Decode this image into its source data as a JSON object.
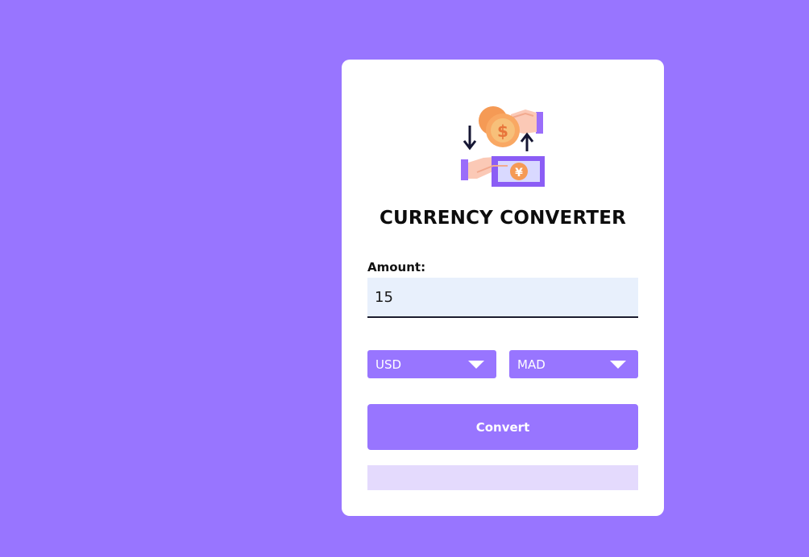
{
  "app": {
    "title": "CURRENCY CONVERTER",
    "logo_icon": "currency-exchange-icon"
  },
  "form": {
    "amount_label": "Amount:",
    "amount_value": "15",
    "from_currency": "USD",
    "to_currency": "MAD",
    "convert_label": "Convert",
    "result_text": ""
  },
  "colors": {
    "background": "#9875ff",
    "card": "#ffffff",
    "accent": "#9875ff",
    "input_bg": "#e8f0fc",
    "result_bg": "#e4dafd"
  }
}
